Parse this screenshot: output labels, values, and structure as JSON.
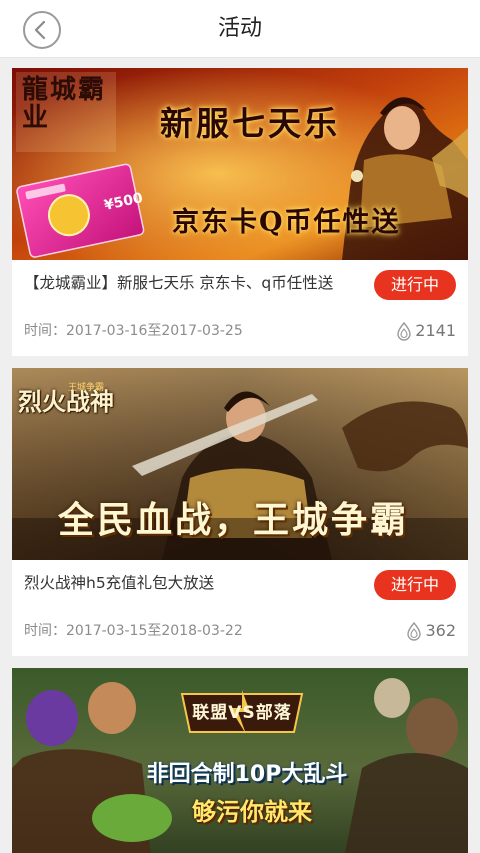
{
  "header": {
    "title": "活动"
  },
  "activities": [
    {
      "banner": {
        "logo": "龍城霸业",
        "headline": "新服七天乐",
        "subline": "京东卡Q币任性送",
        "card_value": "¥500"
      },
      "title": "【龙城霸业】新服七天乐 京东卡、q币任性送",
      "status": "进行中",
      "time_label": "时间：",
      "time_range": "2017-03-16至2017-03-25",
      "views": "2141"
    },
    {
      "banner": {
        "logo": "烈火战神",
        "logo_sub": "王城争霸",
        "headline": "全民血战，王城争霸"
      },
      "title": "烈火战神h5充值礼包大放送",
      "status": "进行中",
      "time_label": "时间：",
      "time_range": "2017-03-15至2018-03-22",
      "views": "362"
    },
    {
      "banner": {
        "logo": "联盟VS部落",
        "headline": "非回合制10P大乱斗",
        "subline": "够污你就来"
      }
    }
  ],
  "colors": {
    "accent": "#e8341f",
    "background": "#efefef"
  }
}
